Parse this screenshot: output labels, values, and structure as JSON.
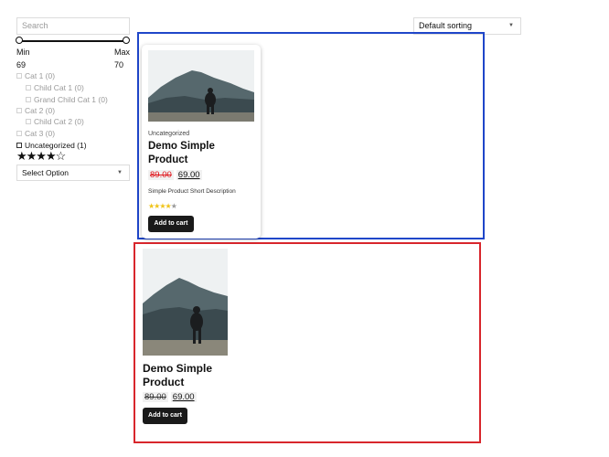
{
  "search": {
    "placeholder": "Search"
  },
  "price_filter": {
    "min_label": "Min",
    "max_label": "Max",
    "min_value": "69",
    "max_value": "70"
  },
  "categories": [
    {
      "label": "Cat 1 (0)",
      "level": 0,
      "active": false
    },
    {
      "label": "Child Cat 1 (0)",
      "level": 1,
      "active": false
    },
    {
      "label": "Grand Child Cat 1 (0)",
      "level": 1,
      "active": false
    },
    {
      "label": "Cat 2 (0)",
      "level": 0,
      "active": false
    },
    {
      "label": "Child Cat 2 (0)",
      "level": 1,
      "active": false
    },
    {
      "label": "Cat 3 (0)",
      "level": 0,
      "active": false
    },
    {
      "label": "Uncategorized (1)",
      "level": 0,
      "active": true
    }
  ],
  "rating_filter": {
    "stars": "★★★★☆",
    "rating": 4,
    "max": 5
  },
  "select_option": {
    "label": "Select Option"
  },
  "sorting": {
    "label": "Default sorting"
  },
  "colors": {
    "blue_box": "#1f46c9",
    "red_box": "#d8262c",
    "old_price": "#e0151b",
    "button": "#1a1a1a"
  },
  "products": [
    {
      "category": "Uncategorized",
      "title": "Demo Simple Product",
      "old_price": "89.00",
      "new_price": "69.00",
      "short_description": "Simple Product Short Description",
      "rating_stars": "★★★★",
      "rating_partial": "★",
      "button": "Add to cart"
    },
    {
      "title": "Demo Simple Product",
      "old_price": "89.00",
      "new_price": "69.00",
      "button": "Add to cart"
    }
  ]
}
